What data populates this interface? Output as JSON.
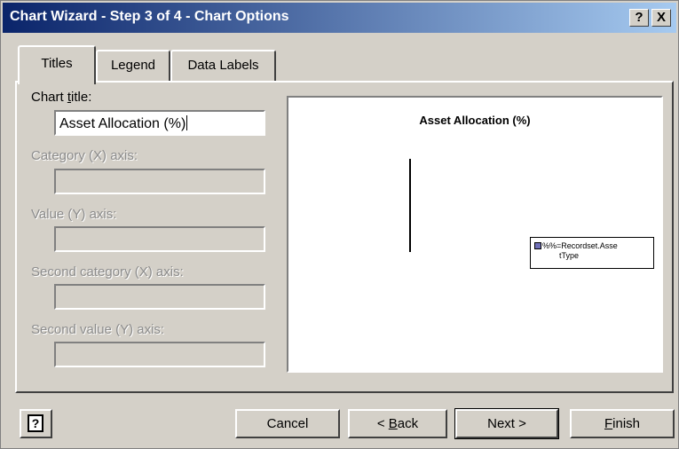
{
  "window": {
    "title": "Chart Wizard - Step 3 of 4 - Chart Options",
    "help_button": "?",
    "close_button": "X"
  },
  "tabs": [
    {
      "label": "Titles",
      "active": true
    },
    {
      "label": "Legend"
    },
    {
      "label": "Data Labels"
    }
  ],
  "fields": {
    "chart_title": {
      "label_pre": "Chart ",
      "label_key": "t",
      "label_post": "itle:",
      "value": "Asset Allocation (%)"
    },
    "category_x": {
      "label": "Category (X) axis:",
      "value": ""
    },
    "value_y": {
      "label": "Value (Y) axis:",
      "value": ""
    },
    "second_category_x": {
      "label": "Second category (X) axis:",
      "value": ""
    },
    "second_value_y": {
      "label": "Second value (Y) axis:",
      "value": ""
    }
  },
  "preview": {
    "title": "Asset Allocation (%)",
    "legend_line1": "%%=Recordset.Asse",
    "legend_line2": "tType",
    "legend_color": "#7070b8"
  },
  "buttons": {
    "help_icon": "help-icon",
    "cancel": "Cancel",
    "back_pre": "< ",
    "back_key": "B",
    "back_post": "ack",
    "next": "Next >",
    "finish_key": "F",
    "finish_post": "inish"
  },
  "colors": {
    "titlebar_start": "#0a246a",
    "titlebar_end": "#a6caf0",
    "face": "#d4d0c8"
  }
}
